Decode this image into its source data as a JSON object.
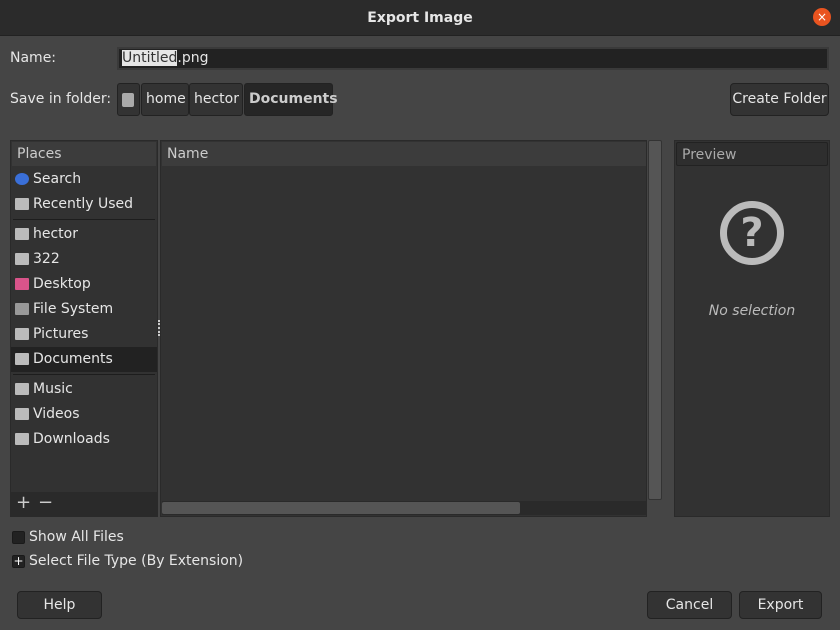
{
  "window": {
    "title": "Export Image",
    "close": "×"
  },
  "name": {
    "label": "Name:",
    "value_selected": "Untitled",
    "value_rest": ".png"
  },
  "folder": {
    "label": "Save in folder:",
    "crumbs": [
      "home",
      "hector",
      "Documents"
    ],
    "create_folder": "Create Folder"
  },
  "places": {
    "header": "Places",
    "items": [
      {
        "label": "Search",
        "icon": "search-icon"
      },
      {
        "label": "Recently Used",
        "icon": "recent-icon"
      },
      {
        "label": "hector",
        "icon": "folder-icon"
      },
      {
        "label": "322",
        "icon": "folder-icon"
      },
      {
        "label": "Desktop",
        "icon": "desktop-icon"
      },
      {
        "label": "File System",
        "icon": "drive-icon"
      },
      {
        "label": "Pictures",
        "icon": "folder-icon"
      },
      {
        "label": "Documents",
        "icon": "folder-icon"
      },
      {
        "label": "Music",
        "icon": "folder-icon"
      },
      {
        "label": "Videos",
        "icon": "folder-icon"
      },
      {
        "label": "Downloads",
        "icon": "folder-icon"
      }
    ],
    "add": "+",
    "remove": "−"
  },
  "files": {
    "column": "Name"
  },
  "preview": {
    "header": "Preview",
    "empty": "No selection",
    "icon": "?"
  },
  "options": {
    "show_all": "Show All Files",
    "file_type": "Select File Type (By Extension)"
  },
  "buttons": {
    "help": "Help",
    "cancel": "Cancel",
    "export": "Export"
  },
  "colors": {
    "accent": "#e95420"
  }
}
